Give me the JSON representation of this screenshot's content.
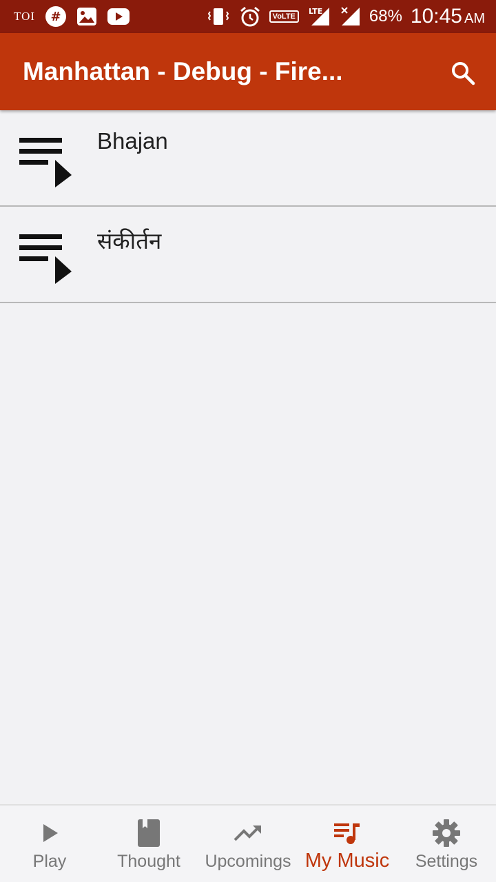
{
  "status_bar": {
    "carrier_label": "TOI",
    "volte": "VoLTE",
    "lte": "LTE",
    "battery": "68%",
    "time": "10:45",
    "ampm": "AM"
  },
  "app_bar": {
    "title": "Manhattan - Debug - Fire...",
    "search_icon": "search-icon"
  },
  "playlists": [
    {
      "label": "Bhajan",
      "icon": "playlist-play-icon"
    },
    {
      "label": "संकीर्तन",
      "icon": "playlist-play-icon"
    }
  ],
  "bottom_nav": {
    "items": [
      {
        "label": "Play",
        "icon": "play-icon",
        "active": false
      },
      {
        "label": "Thought",
        "icon": "book-icon",
        "active": false
      },
      {
        "label": "Upcomings",
        "icon": "trending-up-icon",
        "active": false
      },
      {
        "label": "My Music",
        "icon": "library-music-icon",
        "active": true
      },
      {
        "label": "Settings",
        "icon": "gear-icon",
        "active": false
      }
    ]
  },
  "colors": {
    "status_bar": "#8a1b0b",
    "app_bar": "#bf360c",
    "active": "#bf360c",
    "inactive": "#777777",
    "background": "#f2f2f4"
  }
}
